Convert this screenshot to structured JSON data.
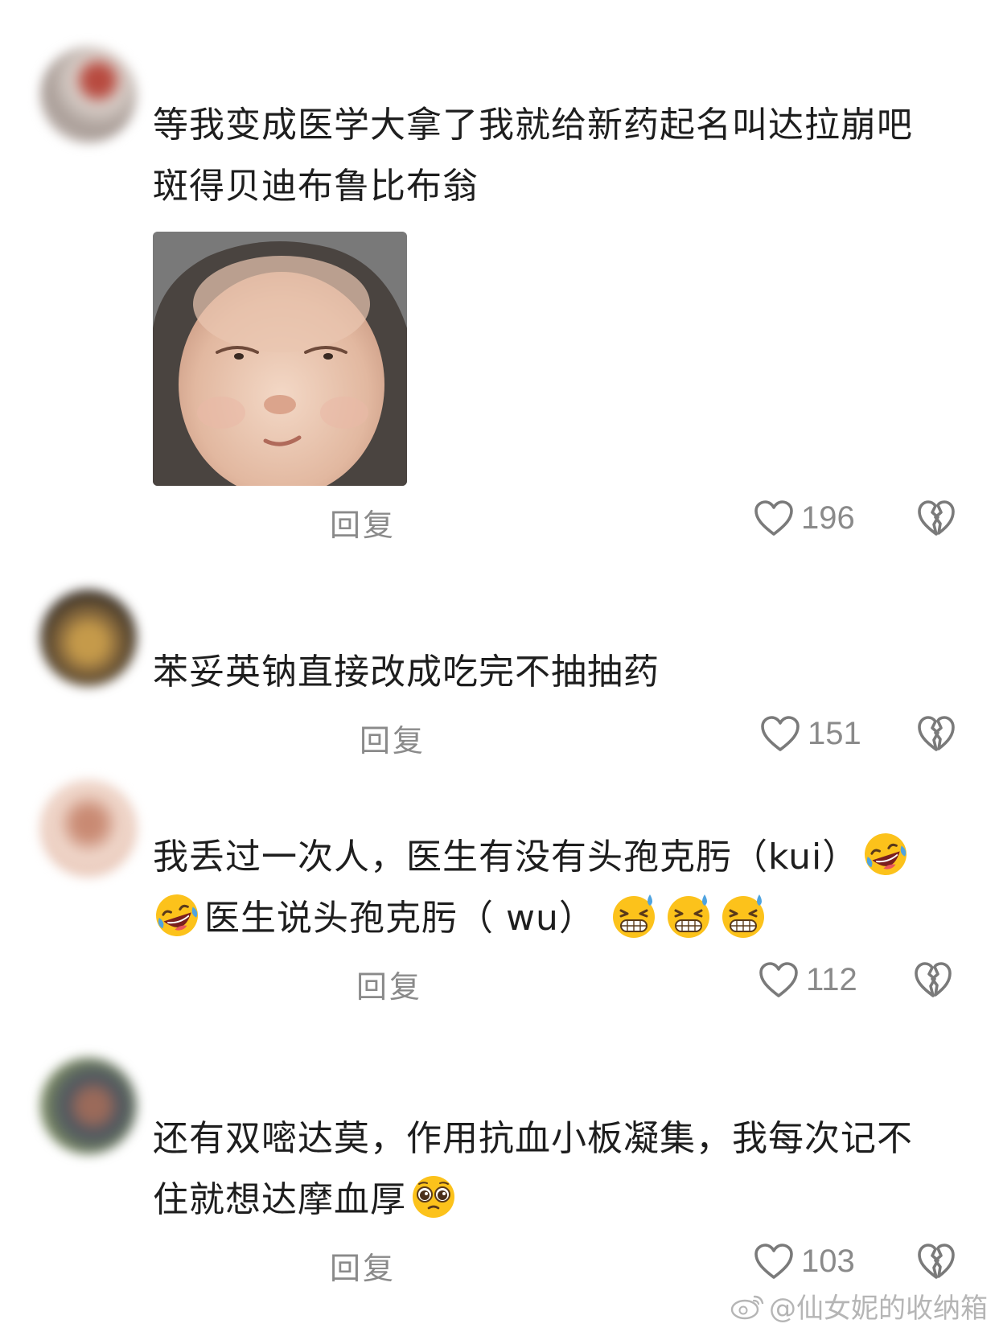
{
  "comments": [
    {
      "lines": [
        "等我变成医学大拿了我就给新药起名叫达拉崩吧",
        "斑得贝迪布鲁比布翁"
      ],
      "reply_label": "回复",
      "likes": "196",
      "avatar_colors": [
        "#d9cfc9",
        "#b84a3f",
        "#7b6f6a"
      ]
    },
    {
      "lines": [
        "苯妥英钠直接改成吃完不抽抽药"
      ],
      "reply_label": "回复",
      "likes": "151",
      "avatar_colors": [
        "#3a3128",
        "#c59a4a",
        "#8a6b3d"
      ]
    },
    {
      "line1": "我丢过一次人，医生有没有头孢克肟（kui）",
      "line2": "医生说头孢克肟（ wu）",
      "reply_label": "回复",
      "likes": "112",
      "avatar_colors": [
        "#f0d8cc",
        "#c98a73",
        "#e7c3b3"
      ]
    },
    {
      "line1": "还有双嘧达莫，作用抗血小板凝集，我每次记不",
      "line2": "住就想达摩血厚",
      "reply_label": "回复",
      "likes": "103",
      "avatar_colors": [
        "#7a8a62",
        "#9b6a5a",
        "#4d5560"
      ]
    }
  ],
  "watermark": "@仙女妮的收纳箱",
  "colors": {
    "text": "#1e1e1e",
    "meta": "#8a8a8a"
  },
  "icons": {
    "like": "heart-outline-icon",
    "dislike": "broken-heart-icon",
    "emoji_laugh_cry": "rolling-on-floor-laughing-emoji",
    "emoji_grin_sweat": "grinning-sweat-emoji",
    "emoji_pleading": "pleading-face-emoji",
    "watermark_logo": "weibo-logo-icon"
  }
}
